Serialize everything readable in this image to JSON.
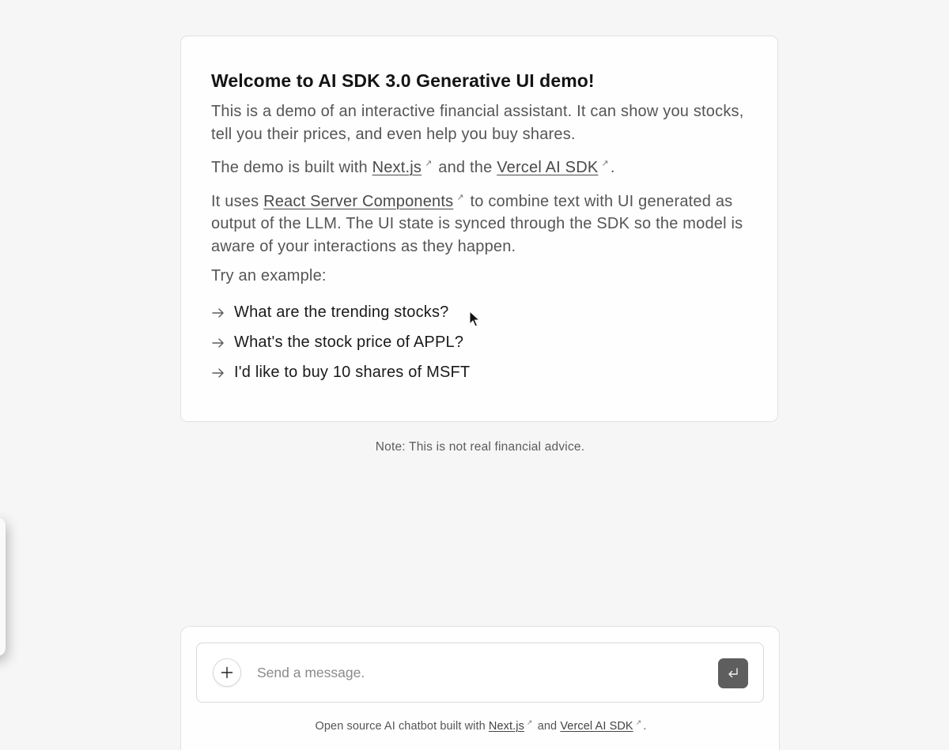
{
  "welcome": {
    "title": "Welcome to AI SDK 3.0 Generative UI demo!",
    "intro": "This is a demo of an interactive financial assistant. It can show you stocks, tell you their prices, and even help you buy shares.",
    "built_prefix": "The demo is built with ",
    "nextjs_link": "Next.js",
    "built_middle": " and the ",
    "vercel_link": "Vercel AI SDK",
    "built_suffix": ".",
    "rsc_prefix": "It uses ",
    "rsc_link": "React Server Components",
    "rsc_suffix": " to combine text with UI generated as output of the LLM. The UI state is synced through the SDK so the model is aware of your interactions as they happen.",
    "try_label": "Try an example:",
    "external_glyph": "↗",
    "examples": [
      "What are the trending stocks?",
      "What's the stock price of APPL?",
      "I'd like to buy 10 shares of MSFT"
    ]
  },
  "note": "Note: This is not real financial advice.",
  "composer": {
    "placeholder": "Send a message.",
    "value": "",
    "footer_prefix": "Open source AI chatbot built with ",
    "footer_nextjs": "Next.js",
    "footer_middle": " and ",
    "footer_vercel": "Vercel AI SDK",
    "footer_suffix": "."
  },
  "icons": {
    "example_arrow": "arrow-right-icon",
    "plus": "plus-icon",
    "send": "enter-icon",
    "external": "external-link-icon",
    "cursor": "mouse-cursor-icon"
  },
  "colors": {
    "background": "#f6f6f6",
    "card": "#fefefe",
    "send_button": "#5e5e5e"
  }
}
